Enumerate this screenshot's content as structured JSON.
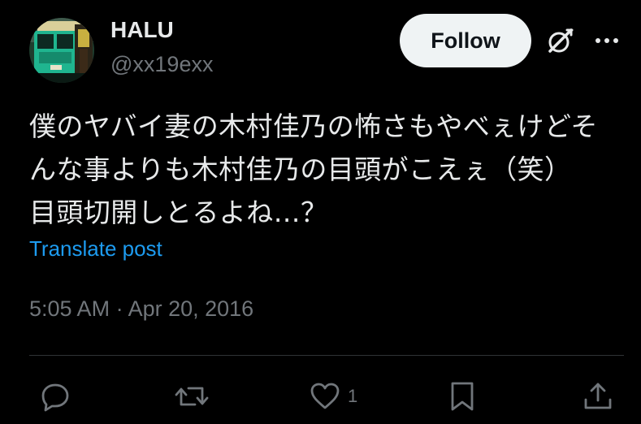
{
  "author": {
    "display_name": "HALU",
    "handle": "@xx19exx"
  },
  "header": {
    "follow_label": "Follow"
  },
  "post": {
    "text_lines": [
      "僕のヤバイ妻の木村佳乃の怖さもやべぇけどそ",
      "んな事よりも木村佳乃の目頭がこえぇ（笑）",
      "目頭切開しとるよね…？"
    ],
    "translate_label": "Translate post",
    "timestamp": "5:05 AM · Apr 20, 2016"
  },
  "actions": {
    "like_count": "1"
  },
  "colors": {
    "background": "#000000",
    "text": "#e7e9ea",
    "secondary": "#71767b",
    "link": "#1d9bf0",
    "button_bg": "#eff3f4"
  },
  "icons": [
    "grok-icon",
    "more-icon",
    "reply-icon",
    "repost-icon",
    "like-icon",
    "bookmark-icon",
    "share-icon"
  ]
}
